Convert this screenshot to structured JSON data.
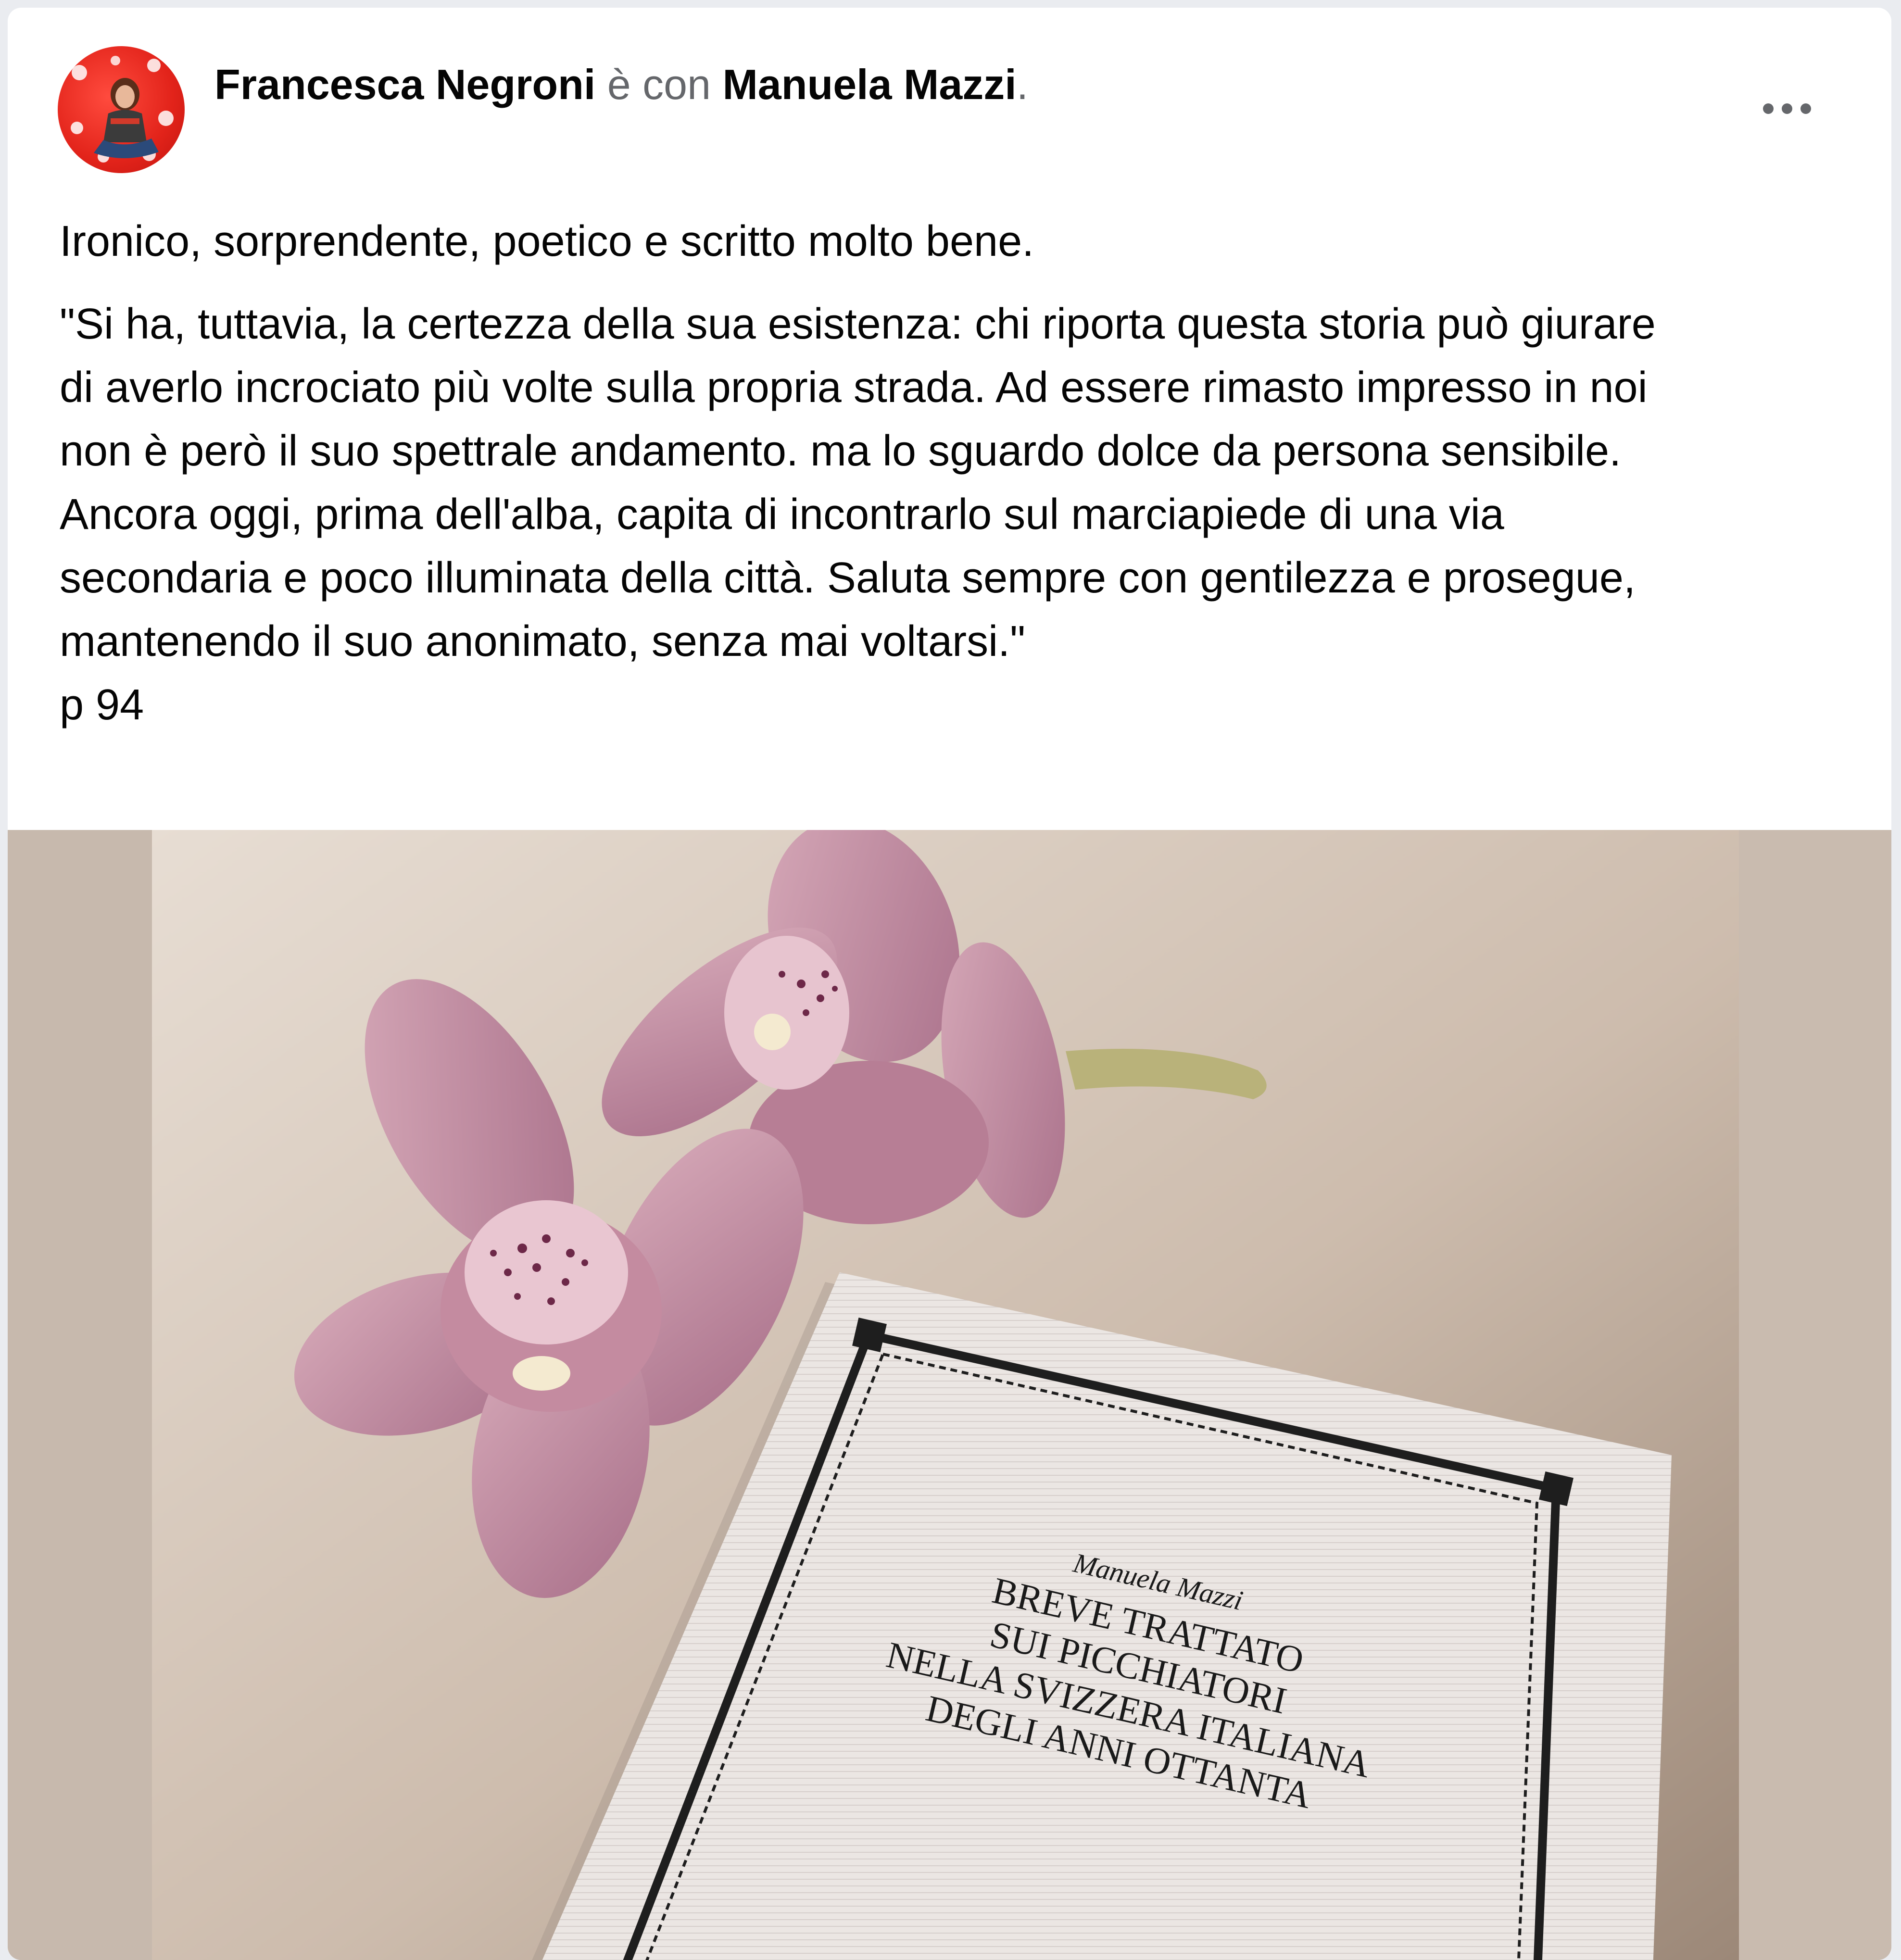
{
  "post": {
    "author": "Francesca Negroni",
    "connector": " è con ",
    "tagged": "Manuela Mazzi",
    "tagged_suffix": ".",
    "menu_icon": "more-horizontal-icon",
    "caption_lead": "Ironico, sorprendente, poetico e scritto molto bene.",
    "caption_quote": "\"Si ha, tuttavia, la certezza della sua esistenza: chi riporta questa storia può giurare\ndi averlo incrociato più volte sulla propria strada. Ad essere rimasto impresso in noi\nnon è però il suo spettrale andamento. ma lo sguardo dolce da persona sensibile.\nAncora oggi, prima dell'alba, capita di incontrarlo sul marciapiede di una via\nsecondaria e poco illuminata della città. Saluta sempre con gentilezza e prosegue,\nmantenendo il suo anonimato, senza mai voltarsi.\"\np 94"
  },
  "photo": {
    "book_author": "Manuela Mazzi",
    "book_title_lines": [
      "BREVE TRATTATO",
      "SUI PICCHIATORI",
      "NELLA SVIZZERA ITALIANA",
      "DEGLI ANNI OTTANTA"
    ]
  },
  "colors": {
    "page_bg": "#eaecf0",
    "card_bg": "#ffffff",
    "text_primary": "#050505",
    "text_secondary": "#65676b",
    "avatar_red": "#e2231a"
  }
}
